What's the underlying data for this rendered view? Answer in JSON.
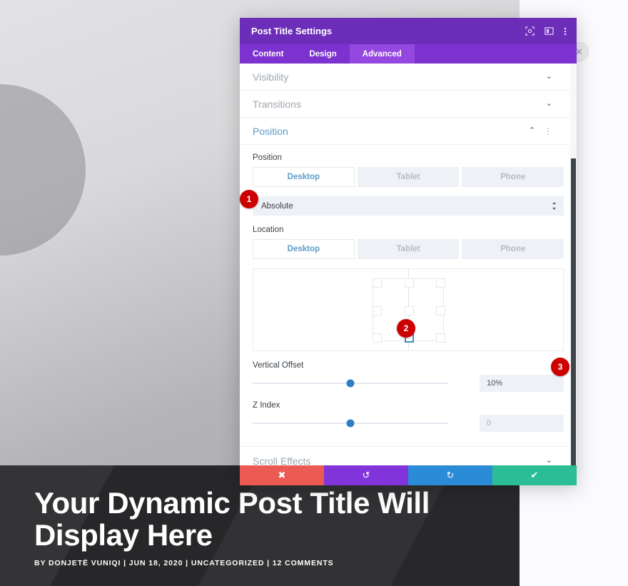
{
  "page": {
    "hero": {
      "title": "Your Dynamic Post Title Will Display Here",
      "meta": "BY DONJETË VUNIQI | JUN 18, 2020 | UNCATEGORIZED | 12 COMMENTS"
    },
    "close_fab_icon": "✕"
  },
  "modal": {
    "title": "Post Title Settings",
    "header_icons": [
      {
        "name": "focus-icon",
        "glyph": "⌖"
      },
      {
        "name": "layout-panel-icon",
        "glyph": "▣"
      },
      {
        "name": "kebab-menu-icon",
        "glyph": "⋮"
      }
    ],
    "tabs": [
      {
        "label": "Content",
        "active": false
      },
      {
        "label": "Design",
        "active": false
      },
      {
        "label": "Advanced",
        "active": true
      }
    ],
    "accordions": [
      {
        "label": "Visibility",
        "open": false,
        "chevron": "⌄"
      },
      {
        "label": "Transitions",
        "open": false,
        "chevron": "⌄"
      },
      {
        "label": "Position",
        "open": true,
        "chevron": "⌃",
        "dots": "⋮"
      },
      {
        "label": "Scroll Effects",
        "open": false,
        "chevron": "⌄"
      }
    ],
    "position_section": {
      "position_label": "Position",
      "position_devices": [
        {
          "label": "Desktop",
          "active": true
        },
        {
          "label": "Tablet",
          "active": false
        },
        {
          "label": "Phone",
          "active": false
        }
      ],
      "position_value": "Absolute",
      "position_arrows": "⇅",
      "location_label": "Location",
      "location_devices": [
        {
          "label": "Desktop",
          "active": true
        },
        {
          "label": "Tablet",
          "active": false
        },
        {
          "label": "Phone",
          "active": false
        }
      ],
      "location_grid": {
        "rows": 3,
        "cols": 3,
        "selected_row": 2,
        "selected_col": 1,
        "selected_name": "bottom-center"
      },
      "vertical_offset": {
        "label": "Vertical Offset",
        "value": "10%",
        "slider_percent": 50
      },
      "z_index": {
        "label": "Z Index",
        "value": "0",
        "is_placeholder": true,
        "slider_percent": 50
      }
    },
    "footer_buttons": [
      {
        "name": "cancel-button",
        "glyph": "✖",
        "color": "#eb5b53"
      },
      {
        "name": "undo-button",
        "glyph": "↺",
        "color": "#8134d9"
      },
      {
        "name": "redo-button",
        "glyph": "↻",
        "color": "#2a8bd6"
      },
      {
        "name": "save-button",
        "glyph": "✔",
        "color": "#2bbd96"
      }
    ]
  },
  "badges": [
    {
      "id": "1",
      "target": "position-type-select"
    },
    {
      "id": "2",
      "target": "location-grid-bottom-center"
    },
    {
      "id": "3",
      "target": "vertical-offset-input"
    }
  ],
  "colors": {
    "header_purple": "#6c2eb9",
    "tabbar_purple": "#7b32cf",
    "tab_active_purple": "#9548e0",
    "accent_blue": "#5b9dc4",
    "slider_blue": "#2f7fc4",
    "badge_red": "#cc0000"
  }
}
